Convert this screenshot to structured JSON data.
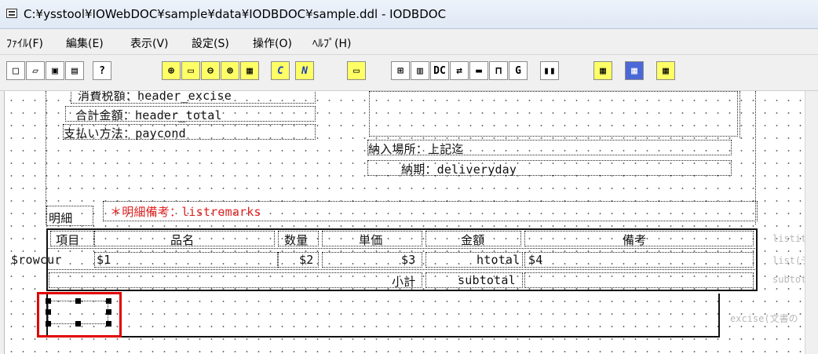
{
  "window": {
    "title": "C:¥ysstool¥IOWebDOC¥sample¥data¥IODBDOC¥sample.ddl - IODBDOC"
  },
  "menu": [
    "ﾌｧｲﾙ(F)",
    "編集(E)",
    "表示(V)",
    "設定(S)",
    "操作(O)",
    "ﾍﾙﾌﾟ(H)"
  ],
  "toolbar": {
    "buttons": [
      {
        "name": "new-file-icon",
        "glyph": "□"
      },
      {
        "name": "open-folder-icon",
        "glyph": "▱"
      },
      {
        "name": "save-icon",
        "glyph": "▣"
      },
      {
        "name": "print-preview-icon",
        "glyph": "▤"
      },
      {
        "name": "help-icon",
        "glyph": "?"
      },
      {
        "name": "zoom-in-icon",
        "glyph": "⊕"
      },
      {
        "name": "fit-page-icon",
        "glyph": "▭"
      },
      {
        "name": "zoom-out-icon",
        "glyph": "⊖"
      },
      {
        "name": "zoom-area-icon",
        "glyph": "⊚"
      },
      {
        "name": "grid-icon",
        "glyph": "▦"
      },
      {
        "name": "text-c-icon",
        "glyph": "C"
      },
      {
        "name": "text-n-icon",
        "glyph": "N"
      },
      {
        "name": "rectangle-icon",
        "glyph": "▭"
      },
      {
        "name": "table-insert-icon",
        "glyph": "⊞"
      },
      {
        "name": "image-icon",
        "glyph": "▥"
      },
      {
        "name": "dc-icon",
        "glyph": "DC"
      },
      {
        "name": "field-icon",
        "glyph": "⇄"
      },
      {
        "name": "frame-icon",
        "glyph": "▬"
      },
      {
        "name": "tree-icon",
        "glyph": "⊓"
      },
      {
        "name": "g-icon",
        "glyph": "G"
      },
      {
        "name": "columns-icon",
        "glyph": "▮▮"
      },
      {
        "name": "layout-1-icon",
        "glyph": "▦"
      },
      {
        "name": "layout-2-icon",
        "glyph": "▦"
      },
      {
        "name": "layout-3-icon",
        "glyph": "▦"
      }
    ]
  },
  "canvas": {
    "header_excise": "消費税額：header_excise ",
    "header_total": "合計金額：header_total ",
    "paycond": "支払い方法：paycond",
    "delivery_place": "納入場所：上記迄",
    "delivery_day": "納期：deliveryday",
    "meisai_label": "明細",
    "listremarks": "＊明細備考：listremarks",
    "col_item": "項目",
    "col_name": "品名",
    "col_qty": "数量",
    "col_price": "単価",
    "col_amount": "金額",
    "col_remarks": "備考",
    "rowcur": "$rowcur",
    "v1": "$1",
    "v2": "$2",
    "v3": "$3",
    "htotal": "htotal",
    "v4": "$4",
    "subtotal_label": "小計",
    "subtotal": "subtotal",
    "ghost_listitem": "listit",
    "ghost_list": "list(デ",
    "ghost_subtotal": "subtota",
    "ghost_excise": "excise(文書の"
  }
}
